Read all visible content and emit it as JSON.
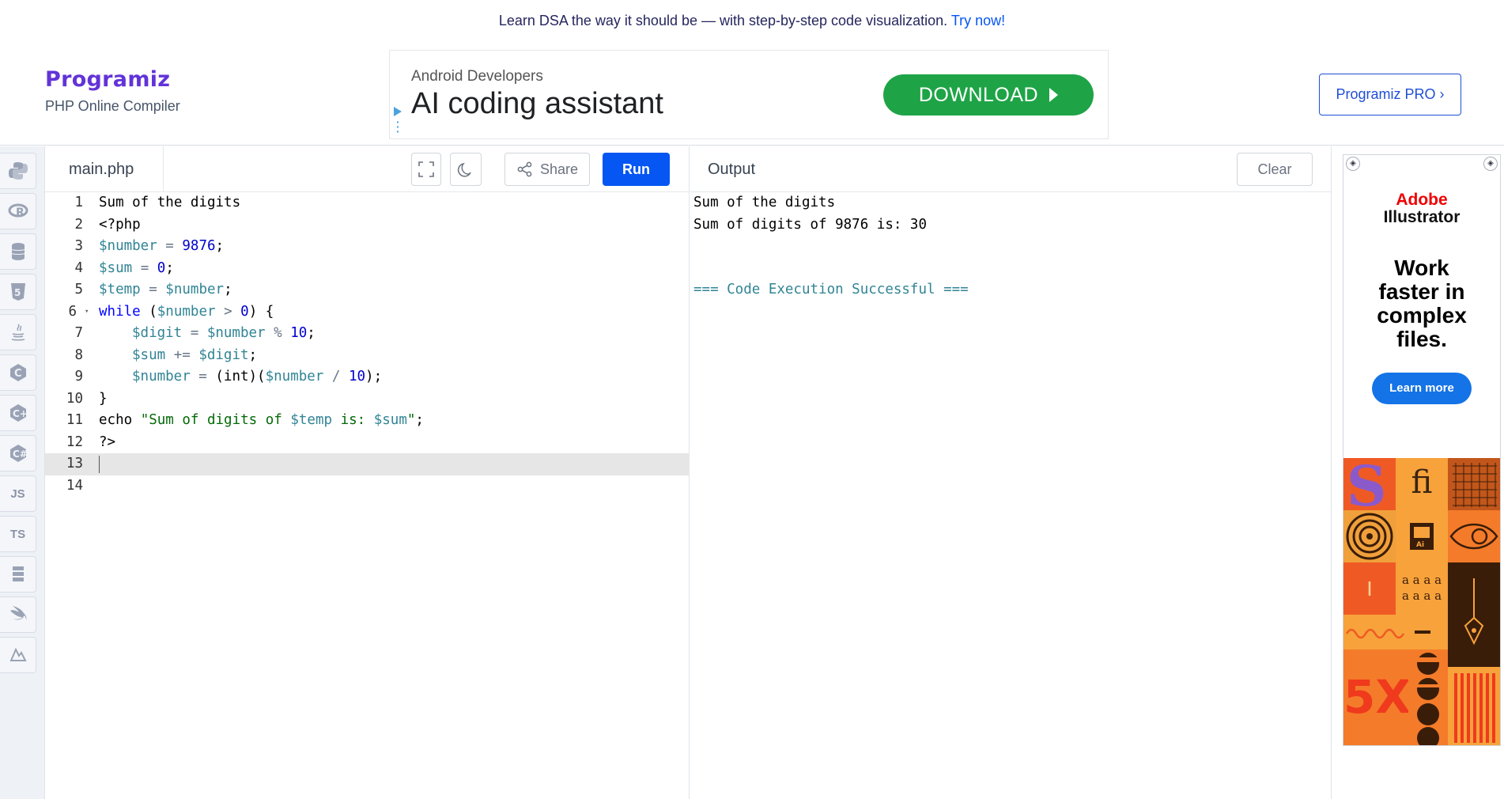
{
  "announcement": {
    "text": "Learn DSA the way it should be — with step-by-step code visualization.",
    "link": "Try now!"
  },
  "brand": {
    "logo": "Programiz",
    "subtitle": "PHP Online Compiler"
  },
  "ad_banner": {
    "advertiser": "Android Developers",
    "headline": "AI coding assistant",
    "cta": "DOWNLOAD"
  },
  "pro_button": "Programiz PRO ›",
  "sidebar": {
    "items": [
      {
        "name": "python",
        "icon": "python-icon"
      },
      {
        "name": "r",
        "icon": "r-icon"
      },
      {
        "name": "sql",
        "icon": "database-icon"
      },
      {
        "name": "html",
        "icon": "html5-icon"
      },
      {
        "name": "java",
        "icon": "java-icon"
      },
      {
        "name": "c",
        "icon": "c-icon"
      },
      {
        "name": "cpp",
        "icon": "cpp-icon"
      },
      {
        "name": "csharp",
        "icon": "csharp-icon"
      },
      {
        "name": "js",
        "label": "JS"
      },
      {
        "name": "ts",
        "label": "TS"
      },
      {
        "name": "sql2",
        "icon": "stack-icon"
      },
      {
        "name": "swift",
        "icon": "swift-icon"
      },
      {
        "name": "rust",
        "icon": "rust-icon"
      }
    ]
  },
  "editor": {
    "file_name": "main.php",
    "share_label": "Share",
    "run_label": "Run",
    "line_numbers": [
      "1",
      "2",
      "3",
      "4",
      "5",
      "6",
      "7",
      "8",
      "9",
      "10",
      "11",
      "12",
      "13",
      "14"
    ],
    "lines": {
      "l1": "Sum of the digits",
      "l2": "<?php",
      "l3_var": "$number",
      "l3_op": " = ",
      "l3_num": "9876",
      "l3_end": ";",
      "l4_var": "$sum",
      "l4_op": " = ",
      "l4_num": "0",
      "l4_end": ";",
      "l5_var": "$temp",
      "l5_op": " = ",
      "l5_var2": "$number",
      "l5_end": ";",
      "l6_kw": "while",
      "l6_a": " (",
      "l6_var": "$number",
      "l6_op": " > ",
      "l6_num": "0",
      "l6_b": ") {",
      "l7_var": "$digit",
      "l7_op": " = ",
      "l7_var2": "$number",
      "l7_op2": " % ",
      "l7_num": "10",
      "l7_end": ";",
      "l8_var": "$sum",
      "l8_op": " += ",
      "l8_var2": "$digit",
      "l8_end": ";",
      "l9_var": "$number",
      "l9_op": " = ",
      "l9_a": "(int)(",
      "l9_var2": "$number",
      "l9_op2": " / ",
      "l9_num": "10",
      "l9_end": ");",
      "l10": "}",
      "l11_a": "echo ",
      "l11_s1": "\"Sum of digits of ",
      "l11_var": "$temp",
      "l11_s2": " is: ",
      "l11_var2": "$sum",
      "l11_s3": "\"",
      "l11_end": ";",
      "l12": "?>"
    },
    "active_line": 13
  },
  "output": {
    "title": "Output",
    "clear_label": "Clear",
    "lines": [
      "Sum of the digits",
      "Sum of digits of 9876 is: 30"
    ],
    "status": "=== Code Execution Successful ==="
  },
  "side_ad": {
    "brand_line1": "Adobe",
    "brand_line2": "Illustrator",
    "headline_1": "Work",
    "headline_2": "faster in",
    "headline_3": "complex",
    "headline_4": "files.",
    "cta": "Learn more",
    "tile_fi": "fi",
    "tile_glyphs_1": "a a a a",
    "tile_glyphs_2": "a a a a",
    "tile_5x": "5X"
  },
  "colors": {
    "accent": "#0556f3",
    "logo": "#6233d8",
    "download": "#1ea446",
    "adobe_red": "#ee0000"
  }
}
